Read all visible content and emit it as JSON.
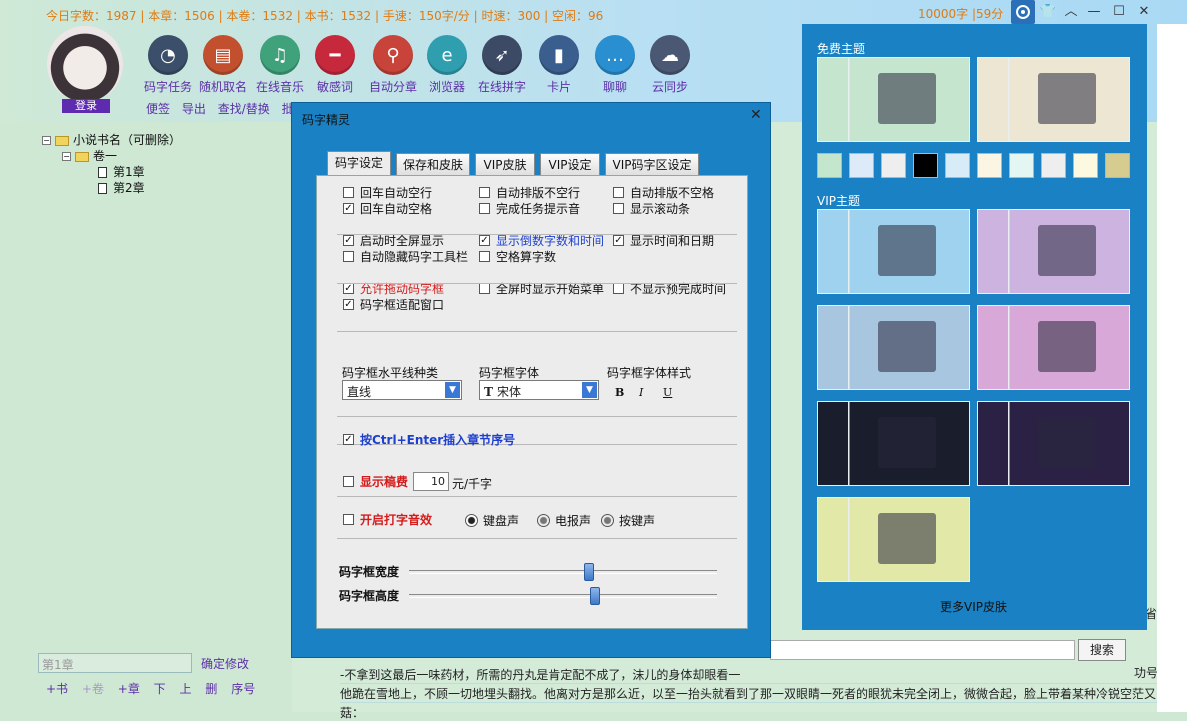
{
  "top": {
    "stats": "今日字数：1987 | 本章：1506 | 本卷：1532 | 本书：1532 | 手速：150字/分 | 时速：300 | 空闲：96",
    "speed": "10000字 |59分",
    "login": "登录"
  },
  "tools": [
    {
      "label": "码字任务",
      "icon": "gauge-icon",
      "color": "#3b4f6a"
    },
    {
      "label": "随机取名",
      "icon": "book-icon",
      "color": "#c2502f"
    },
    {
      "label": "在线音乐",
      "icon": "music-icon",
      "color": "#3fa27a"
    },
    {
      "label": "敏感词",
      "icon": "minus-icon",
      "color": "#c6283c"
    },
    {
      "label": "自动分章",
      "icon": "compass-icon",
      "color": "#c8433a"
    },
    {
      "label": "浏览器",
      "icon": "browser-icon",
      "color": "#2f9fb0"
    },
    {
      "label": "在线拼字",
      "icon": "rocket-icon",
      "color": "#3c4a66"
    },
    {
      "label": "卡片",
      "icon": "bookmark-icon",
      "color": "#3a5f8e"
    },
    {
      "label": "聊聊",
      "icon": "chat-icon",
      "color": "#2a8fd0"
    },
    {
      "label": "云同步",
      "icon": "cloud-icon",
      "color": "#4b5873"
    }
  ],
  "subtools": [
    "便签",
    "导出",
    "查找/替换",
    "批量"
  ],
  "tree": {
    "book": "小说书名（可删除）",
    "volume": "卷一",
    "chapters": [
      "第1章",
      "第2章"
    ]
  },
  "left_bottom": {
    "chapter_input": "第1章",
    "confirm": "确定修改",
    "actions": [
      "+书",
      "+卷",
      "+章",
      "下",
      "上",
      "删",
      "序号"
    ]
  },
  "editor": {
    "search": "搜索",
    "lines": [
      "-不拿到这最后一味药材，所需的丹丸是肯定配不成了，沫儿的身体却眼看一",
      "他跪在雪地上，不顾一切地埋头翻找。他离对方是那么近，以至一抬头就看到了那一双眼睛一死者的眼犹未完全闭上，微微合起，脸上带着某种冷锐空茫又的",
      "菇："
    ],
    "right_cut": "省",
    "right_cut2": "功号"
  },
  "dialog": {
    "title": "码字精灵",
    "tabs": [
      "码字设定",
      "保存和皮肤",
      "VIP皮肤",
      "VIP设定",
      "VIP码字区设定"
    ],
    "checks": [
      {
        "label": "回车自动空行",
        "checked": false
      },
      {
        "label": "自动排版不空行",
        "checked": false
      },
      {
        "label": "自动排版不空格",
        "checked": false
      },
      {
        "label": "回车自动空格",
        "checked": true
      },
      {
        "label": "完成任务提示音",
        "checked": false
      },
      {
        "label": "显示滚动条",
        "checked": false
      },
      {
        "label": "启动时全屏显示",
        "checked": true
      },
      {
        "label": "显示倒数字数和时间",
        "checked": true
      },
      {
        "label": "显示时间和日期",
        "checked": true
      },
      {
        "label": "自动隐藏码字工具栏",
        "checked": false
      },
      {
        "label": "空格算字数",
        "checked": false
      },
      {
        "label": "允许拖动码字框",
        "checked": true
      },
      {
        "label": "全屏时显示开始菜单",
        "checked": false
      },
      {
        "label": "不显示预完成时间",
        "checked": false
      },
      {
        "label": "码字框适配窗口",
        "checked": true
      }
    ],
    "line_type_label": "码字框水平线种类",
    "line_type_value": "直线",
    "font_label": "码字框字体",
    "font_value": "宋体",
    "font_style_label": "码字框字体样式",
    "font_styles": [
      "B",
      "I",
      "U"
    ],
    "ctrl_enter": "按Ctrl+Enter插入章节序号",
    "show_fee": "显示稿费",
    "fee_value": "10",
    "fee_unit": "元/千字",
    "typing_sound": "开启打字音效",
    "radios": [
      {
        "label": "键盘声",
        "on": true
      },
      {
        "label": "电报声",
        "on": false
      },
      {
        "label": "按键声",
        "on": false
      }
    ],
    "width_label": "码字框宽度",
    "height_label": "码字框高度",
    "width_level": 0.59,
    "height_level": 0.61
  },
  "skin": {
    "free_title": "免费主题",
    "vip_title": "VIP主题",
    "more": "更多VIP皮肤",
    "swatches": [
      "#c4e6cc",
      "#dcebf7",
      "#eeeeee",
      "#000000",
      "#d8ecf8",
      "#fbf6e4",
      "#e4f6f2",
      "#eeeeee",
      "#fbf9e0",
      "#d6cc90"
    ],
    "free_thumbs": [
      "#c5e5cf",
      "#ece6d3"
    ],
    "vip_thumbs": [
      "#9fd2ee",
      "#cdb3e0",
      "#a9c6e0",
      "#d8a8d8",
      "#1a1e2c",
      "#2a2145",
      "#e2e8a8"
    ]
  }
}
